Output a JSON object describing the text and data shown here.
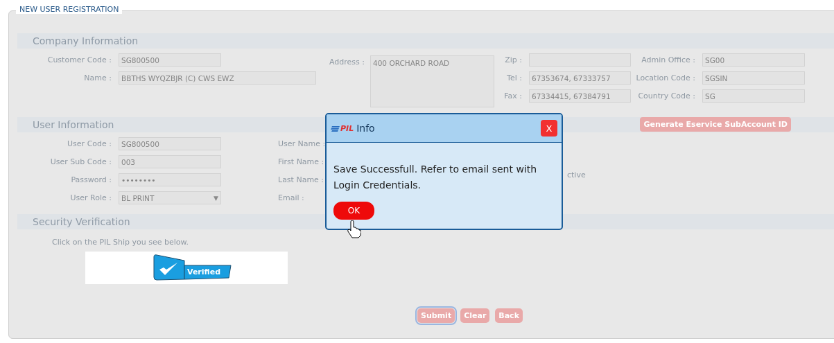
{
  "legend": "NEW USER REGISTRATION",
  "company": {
    "title": "Company Information",
    "left": [
      {
        "label": "Customer Code :",
        "value": "SG800500",
        "kind": "text"
      },
      {
        "label": "Name :",
        "value": "BBTHS WYQZBJR (C) CWS EWZ",
        "kind": "wide"
      }
    ],
    "address": {
      "label": "Address :",
      "value": "400 ORCHARD ROAD"
    },
    "contact": [
      {
        "label": "Zip :"
      },
      {
        "label": "Tel :",
        "value": "67353674, 67333757"
      },
      {
        "label": "Fax :",
        "value": "67334415, 67384791"
      }
    ],
    "office": [
      {
        "label": "Admin Office :",
        "value": "SG00"
      },
      {
        "label": "Location Code :",
        "value": "SGSIN"
      },
      {
        "label": "Country Code :",
        "value": "SG"
      }
    ]
  },
  "user": {
    "title": "User Information",
    "generate_button": "Generate Eservice SubAccount ID",
    "left": [
      {
        "label": "User Code :",
        "value": "SG800500",
        "kind": "text"
      },
      {
        "label": "User Sub Code :",
        "value": "003",
        "kind": "text"
      },
      {
        "label": "Password :",
        "value": "••••••••",
        "kind": "text"
      },
      {
        "label": "User Role :",
        "value": "BL PRINT",
        "kind": "select",
        "arrow": "▼"
      }
    ],
    "middle_labels": [
      "User Name :",
      "First Name :",
      "Last Name :",
      "Email :"
    ],
    "status_fragment": "ctive"
  },
  "security": {
    "title": "Security Verification",
    "instruction": "Click on the PIL Ship you see below.",
    "badge": "Verified"
  },
  "buttons": [
    {
      "label": "Submit",
      "focused": true
    },
    {
      "label": "Clear",
      "focused": false
    },
    {
      "label": "Back",
      "focused": false
    }
  ],
  "dialog": {
    "logo": "PIL",
    "title": "Info",
    "close": "X",
    "message": "Save Successfull. Refer to email sent with Login Credentials.",
    "ok": "OK"
  }
}
